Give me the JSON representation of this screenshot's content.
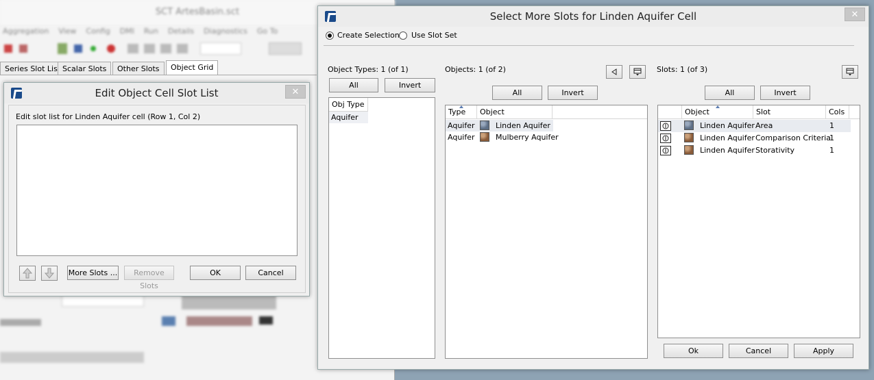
{
  "background_window": {
    "tabs": [
      "Series Slot List",
      "Scalar Slots",
      "Other Slots",
      "Object Grid"
    ],
    "active_tab": "Object Grid"
  },
  "edit_dialog": {
    "title": "Edit Object Cell Slot List",
    "prompt": "Edit slot list for Linden Aquifer cell (Row 1, Col 2)",
    "more_slots_label": "More Slots ...",
    "remove_slots_label": "Remove Slots",
    "ok_label": "OK",
    "cancel_label": "Cancel",
    "close_glyph": "✕"
  },
  "select_dialog": {
    "title": "Select More Slots for Linden Aquifer Cell",
    "close_glyph": "✕",
    "mode_create": "Create Selection",
    "mode_slotset": "Use Slot Set",
    "selected_mode": "Create Selection",
    "object_types": {
      "label": "Object Types: 1 (of 1)",
      "all_label": "All",
      "invert_label": "Invert",
      "column": "Obj Type",
      "rows": [
        "Aquifer"
      ]
    },
    "objects": {
      "label": "Objects: 1 (of 2)",
      "all_label": "All",
      "invert_label": "Invert",
      "columns": [
        "Type",
        "Object"
      ],
      "rows": [
        {
          "type": "Aquifer",
          "object": "Linden Aquifer",
          "icon": "aquifer-blue-icon",
          "selected": true
        },
        {
          "type": "Aquifer",
          "object": "Mulberry Aquifer",
          "icon": "aquifer-brown-icon",
          "selected": false
        }
      ]
    },
    "slots": {
      "label": "Slots: 1 (of 3)",
      "all_label": "All",
      "invert_label": "Invert",
      "columns": [
        "Object",
        "Slot",
        "Cols"
      ],
      "rows": [
        {
          "object": "Linden Aquifer",
          "slot": "Area",
          "cols": "1",
          "selected": true
        },
        {
          "object": "Linden Aquifer",
          "slot": "Comparison Criteria",
          "cols": "1",
          "selected": false
        },
        {
          "object": "Linden Aquifer",
          "slot": "Storativity",
          "cols": "1",
          "selected": false
        }
      ]
    },
    "ok_label": "Ok",
    "cancel_label": "Cancel",
    "apply_label": "Apply"
  },
  "colors": {
    "accent_logo": "#1a4a8a",
    "selection_row": "#e8ebf0",
    "desktop": "#8ea3b4"
  }
}
